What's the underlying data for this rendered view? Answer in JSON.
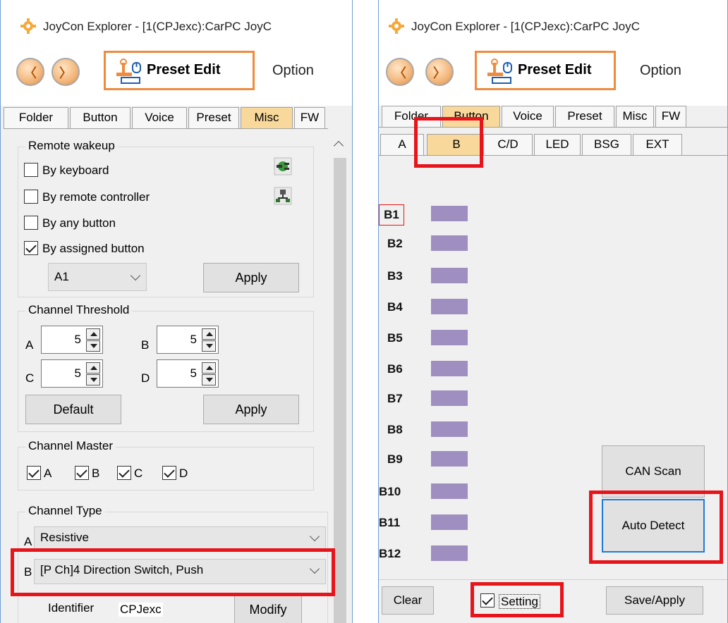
{
  "left_window": {
    "title": "JoyCon Explorer - [1(CPJexc):CarPC JoyC",
    "toolbar": {
      "back_glyph": "〈",
      "forward_glyph": "〉",
      "preset_edit_label": "Preset Edit",
      "option_label": "Option"
    },
    "tabs": [
      "Folder",
      "Button",
      "Voice",
      "Preset",
      "Misc",
      "FW"
    ],
    "active_tab": "Misc",
    "remote_wakeup": {
      "title": "Remote wakeup",
      "options": [
        {
          "label": "By keyboard",
          "checked": false
        },
        {
          "label": "By remote controller",
          "checked": false
        },
        {
          "label": "By any button",
          "checked": false
        },
        {
          "label": "By assigned button",
          "checked": true
        }
      ],
      "assigned_select": "A1",
      "apply_label": "Apply",
      "icons": [
        "plug-icon",
        "network-icon"
      ]
    },
    "channel_threshold": {
      "title": "Channel Threshold",
      "channels": [
        {
          "name": "A",
          "value": "5"
        },
        {
          "name": "B",
          "value": "5"
        },
        {
          "name": "C",
          "value": "5"
        },
        {
          "name": "D",
          "value": "5"
        }
      ],
      "default_label": "Default",
      "apply_label": "Apply"
    },
    "channel_master": {
      "title": "Channel Master",
      "items": [
        {
          "label": "A",
          "checked": true
        },
        {
          "label": "B",
          "checked": true
        },
        {
          "label": "C",
          "checked": true
        },
        {
          "label": "D",
          "checked": true
        }
      ]
    },
    "channel_type": {
      "title": "Channel Type",
      "rows": [
        {
          "channel": "A",
          "value": "Resistive"
        },
        {
          "channel": "B",
          "value": "[P Ch]4 Direction Switch, Push"
        }
      ],
      "identifier_label": "Identifier",
      "identifier_value": "CPJexc",
      "modify_label": "Modify"
    }
  },
  "right_window": {
    "title": "JoyCon Explorer - [1(CPJexc):CarPC JoyC",
    "toolbar": {
      "back_glyph": "〈",
      "forward_glyph": "〉",
      "preset_edit_label": "Preset Edit",
      "option_label": "Option"
    },
    "tabs": [
      "Folder",
      "Button",
      "Voice",
      "Preset",
      "Misc",
      "FW"
    ],
    "active_tab": "Button",
    "subtabs": [
      "A",
      "B",
      "C/D",
      "LED",
      "BSG",
      "EXT"
    ],
    "active_subtab": "B",
    "buttons": [
      "B1",
      "B2",
      "B3",
      "B4",
      "B5",
      "B6",
      "B7",
      "B8",
      "B9",
      "B10",
      "B11",
      "B12"
    ],
    "selected_button": "B1",
    "can_scan_label": "CAN Scan",
    "auto_detect_label": "Auto Detect",
    "clear_label": "Clear",
    "setting_label": "Setting",
    "setting_checked": true,
    "save_apply_label": "Save/Apply"
  },
  "colors": {
    "highlight": "#e8141b",
    "active_tab": "#f9d99b",
    "button_bar": "#9f8fc0",
    "preset_edit_border": "#f08a3c",
    "focus_border": "#1e7bd8",
    "window_border": "#6d9fd6"
  }
}
